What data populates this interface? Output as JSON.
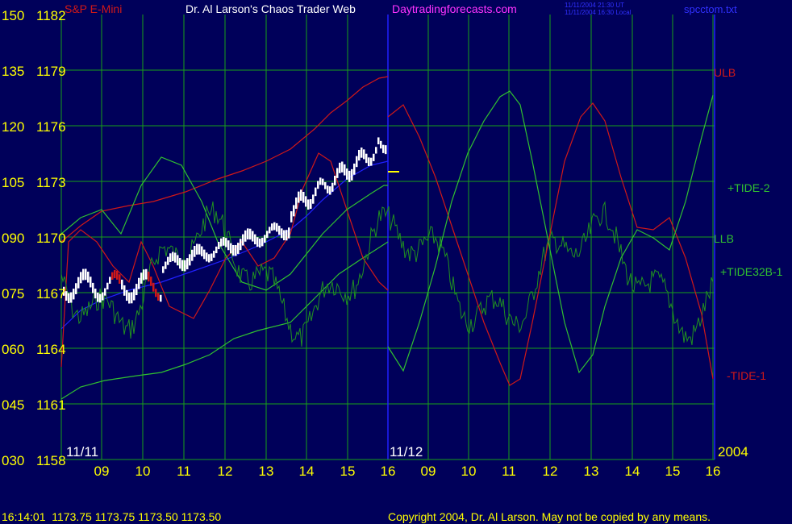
{
  "header": {
    "title_left": "S&P E-Mini",
    "title_main": "Dr. Al Larson's Chaos Trader Web",
    "title_site": "Daytradingforecasts.com",
    "stamp_ut": "11/11/2004 21:30 UT",
    "stamp_local": "11/11/2004 16:30 Local",
    "filename": "spcctom.txt"
  },
  "axis": {
    "left_labels": [
      {
        "osc": "150",
        "price": "1182"
      },
      {
        "osc": "135",
        "price": "1179"
      },
      {
        "osc": "120",
        "price": "1176"
      },
      {
        "osc": "105",
        "price": "1173"
      },
      {
        "osc": "090",
        "price": "1170"
      },
      {
        "osc": "075",
        "price": "1167"
      },
      {
        "osc": "060",
        "price": "1164"
      },
      {
        "osc": "045",
        "price": "1161"
      },
      {
        "osc": "030",
        "price": "1158"
      }
    ],
    "hours_day1": [
      "09",
      "10",
      "11",
      "12",
      "13",
      "14",
      "15",
      "16"
    ],
    "hours_day2": [
      "09",
      "10",
      "11",
      "12",
      "13",
      "14",
      "15",
      "16"
    ],
    "date_day1": "11/11",
    "date_day2": "11/12",
    "year": "2004"
  },
  "labels": {
    "ulb": "ULB",
    "tide2": "+TIDE-2",
    "llb": "LLB",
    "tide32": "+TIDE32B-1",
    "tide1": "-TIDE-1"
  },
  "footer": {
    "quote": "16:14:01  1173.75 1173.75 1173.50 1173.50",
    "copyright": "Copyright 2004, Dr. Al Larson. May not be copied by any means."
  },
  "colors": {
    "background": "#00005a",
    "grid": "#18a018",
    "axis_text": "#ffff00",
    "date_text": "#ffffff",
    "hour_text": "#ffff00",
    "red_line": "#d01818",
    "green_line": "#30c030",
    "dark_green_line": "#209020",
    "blue_line": "#2020ff",
    "price_bar": "#ffffff"
  },
  "chart_data": {
    "type": "line",
    "ylim_price": [
      1158,
      1182
    ],
    "ylim_osc": [
      30,
      150
    ],
    "x_hours_day1": [
      9,
      10,
      11,
      12,
      13,
      14,
      15,
      16
    ],
    "x_hours_day2": [
      9,
      10,
      11,
      12,
      13,
      14,
      15,
      16
    ],
    "last_price": 1173.5,
    "series": [
      {
        "name": "ULB",
        "color": "red"
      },
      {
        "name": "+TIDE-2",
        "color": "green"
      },
      {
        "name": "LLB",
        "color": "green"
      },
      {
        "name": "+TIDE32B-1",
        "color": "darkgreen"
      },
      {
        "name": "-TIDE-1",
        "color": "red"
      }
    ]
  }
}
